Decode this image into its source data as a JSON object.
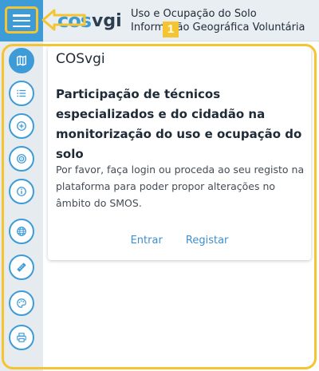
{
  "header": {
    "menu_icon": "menu-icon",
    "logo": {
      "part1": "cos",
      "part2": "vgi"
    },
    "title_line1": "Uso e Ocupação do Solo",
    "title_line2": "Informação Geográfica Voluntária"
  },
  "annotation": {
    "badge": "1",
    "color": "#f4c531"
  },
  "sidebar": {
    "items": [
      {
        "name": "map",
        "icon": "map-icon",
        "active": true
      },
      {
        "name": "list",
        "icon": "list-icon"
      },
      {
        "name": "add",
        "icon": "plus-circle-icon"
      },
      {
        "name": "target",
        "icon": "target-icon"
      },
      {
        "name": "info",
        "icon": "info-icon"
      },
      {
        "name": "globe",
        "icon": "globe-icon"
      },
      {
        "name": "measure",
        "icon": "ruler-icon"
      },
      {
        "name": "palette",
        "icon": "palette-icon"
      },
      {
        "name": "print",
        "icon": "printer-icon"
      }
    ]
  },
  "card": {
    "title": "COSvgi",
    "heading": "Participação de técnicos especializados e do cidadão na monitorização do uso e ocupação do solo",
    "text": "Por favor, faça login ou proceda ao seu registo na plataforma para poder propor alterações no âmbito do SMOS.",
    "login_label": "Entrar",
    "register_label": "Registar"
  },
  "colors": {
    "accent": "#3d9bd8",
    "sidebar_bg": "#e6ebf0",
    "header_bg": "#e9eef3"
  }
}
